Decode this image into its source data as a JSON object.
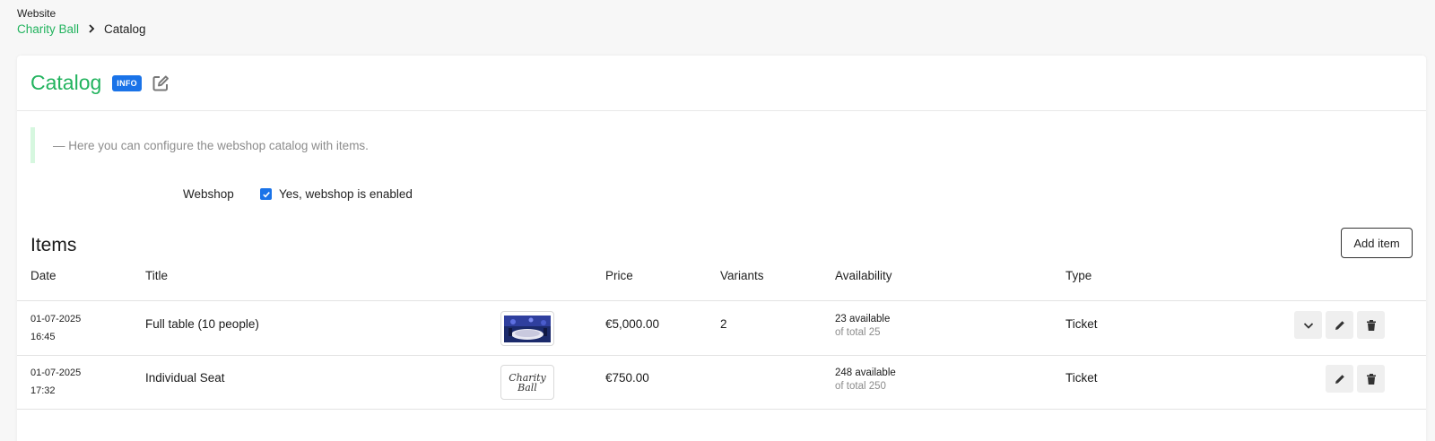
{
  "top_label": "Website",
  "breadcrumb": {
    "parent": "Charity Ball",
    "current": "Catalog"
  },
  "header": {
    "title": "Catalog",
    "badge": "INFO"
  },
  "intro_text": "— Here you can configure the webshop catalog with items.",
  "webshop": {
    "label": "Webshop",
    "checkbox_label": "Yes, webshop is enabled",
    "checked": true
  },
  "items": {
    "title": "Items",
    "add_button": "Add item",
    "columns": [
      "Date",
      "Title",
      "Price",
      "Variants",
      "Availability",
      "Type"
    ],
    "rows": [
      {
        "date": "01-07-2025",
        "time": "16:45",
        "title": "Full table (10 people)",
        "price": "€5,000.00",
        "variants": "2",
        "available": "23 available",
        "total": "of total 25",
        "type": "Ticket"
      },
      {
        "date": "01-07-2025",
        "time": "17:32",
        "title": "Individual Seat",
        "price": "€750.00",
        "variants": "",
        "available": "248 available",
        "total": "of total 250",
        "type": "Ticket",
        "thumb_text_1": "Charity",
        "thumb_text_2": "Ball"
      }
    ]
  },
  "colors": {
    "accent": "#22b35e",
    "badge": "#1a73e8"
  }
}
